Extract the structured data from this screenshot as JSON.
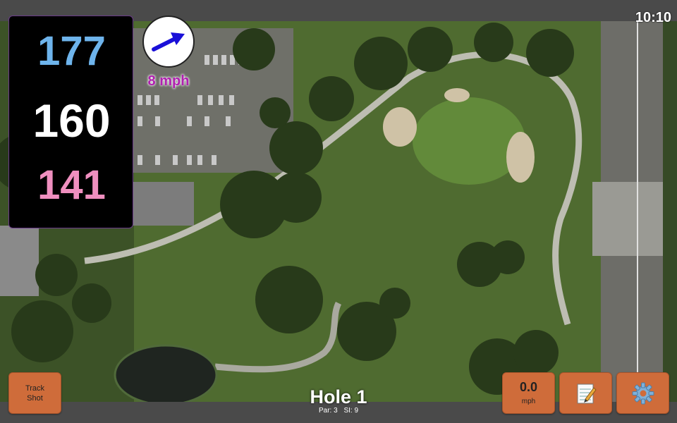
{
  "status": {
    "time": "10:10"
  },
  "distances": {
    "back": "177",
    "middle": "160",
    "front": "141"
  },
  "wind": {
    "speed_label": "8 mph",
    "direction_icon": "wind-arrow-icon"
  },
  "hole": {
    "title": "Hole 1",
    "par_label": "Par: 3",
    "si_label": "SI: 9"
  },
  "buttons": {
    "track_line1": "Track",
    "track_line2": "Shot",
    "speed_value": "0.0",
    "speed_unit": "mph",
    "notes_icon": "notepad-icon",
    "settings_icon": "gear-icon"
  },
  "colors": {
    "back": "#6eb4ec",
    "middle": "#ffffff",
    "front": "#ef8fbf",
    "wind_text": "#b020b0",
    "button": "#cf6c3a"
  }
}
